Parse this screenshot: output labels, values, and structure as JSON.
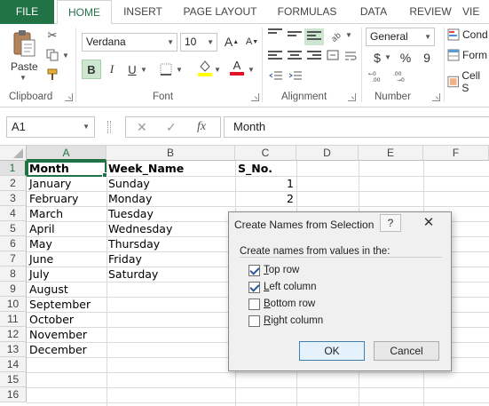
{
  "ribbon": {
    "tabs": [
      "FILE",
      "HOME",
      "INSERT",
      "PAGE LAYOUT",
      "FORMULAS",
      "DATA",
      "REVIEW",
      "VIE"
    ],
    "clipboard": {
      "paste_label": "Paste",
      "group_label": "Clipboard"
    },
    "font": {
      "name": "Verdana",
      "size": "10",
      "group_label": "Font",
      "bold": "B",
      "italic": "I",
      "underline": "U",
      "grow": "A",
      "shrink": "A",
      "font_color": "A"
    },
    "alignment": {
      "group_label": "Alignment"
    },
    "number": {
      "format": "General",
      "currency": "$",
      "percent": "%",
      "comma": "9",
      "group_label": "Number"
    },
    "styles": {
      "cond": "Cond",
      "format": "Form",
      "cell": "Cell S"
    }
  },
  "formula_bar": {
    "name_box": "A1",
    "fx": "fx",
    "content": "Month"
  },
  "grid": {
    "columns": [
      "A",
      "B",
      "C",
      "D",
      "E",
      "F"
    ],
    "rows": [
      "1",
      "2",
      "3",
      "4",
      "5",
      "6",
      "7",
      "8",
      "9",
      "10",
      "11",
      "12",
      "13",
      "14",
      "15",
      "16"
    ],
    "headers": {
      "a": "Month",
      "b": "Week_Name",
      "c": "S_No."
    },
    "months": [
      "January",
      "February",
      "March",
      "April",
      "May",
      "June",
      "July",
      "August",
      "September",
      "October",
      "November",
      "December"
    ],
    "weekdays": [
      "Sunday",
      "Monday",
      "Tuesday",
      "Wednesday",
      "Thursday",
      "Friday",
      "Saturday"
    ],
    "s_no": [
      "1",
      "2"
    ]
  },
  "dialog": {
    "title": "Create Names from Selection",
    "help": "?",
    "close": "✕",
    "group_label": "Create names from values in the:",
    "options": [
      {
        "key": "T",
        "rest": "op row",
        "checked": true
      },
      {
        "key": "L",
        "rest": "eft column",
        "checked": true
      },
      {
        "key": "B",
        "rest": "ottom row",
        "checked": false
      },
      {
        "key": "R",
        "rest": "ight column",
        "checked": false
      }
    ],
    "ok": "OK",
    "cancel": "Cancel"
  },
  "colors": {
    "excel_green": "#217346",
    "pressed": "#cde6cf",
    "dialog_bg": "#f0f0f0"
  }
}
